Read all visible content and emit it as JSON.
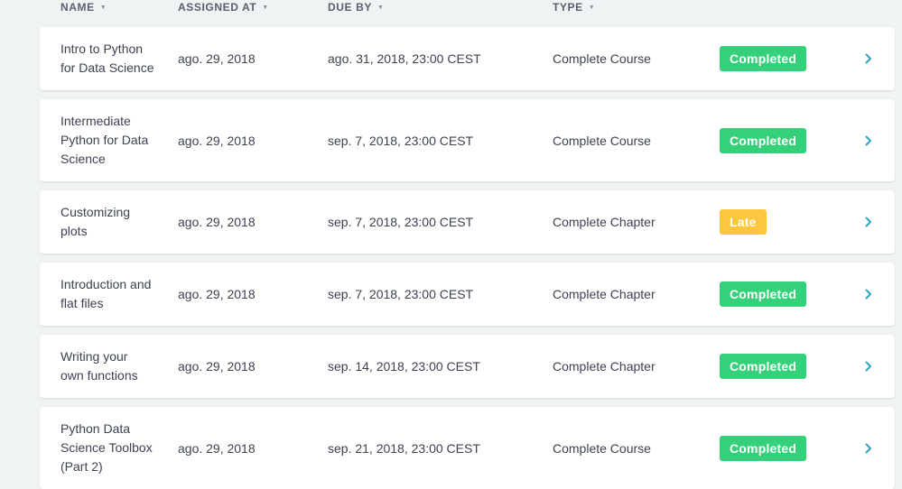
{
  "columns": {
    "name": "NAME",
    "assigned_at": "ASSIGNED AT",
    "due_by": "DUE BY",
    "type": "TYPE"
  },
  "colors": {
    "completed": "#34d17a",
    "late": "#fec63f",
    "chevron": "#33a3c0"
  },
  "rows": [
    {
      "name_lines": [
        "Intro to Python",
        "for Data Science"
      ],
      "assigned": "ago. 29, 2018",
      "due": "ago. 31, 2018, 23:00 CEST",
      "type": "Complete Course",
      "status": "Completed",
      "status_kind": "completed"
    },
    {
      "name_lines": [
        "Intermediate",
        "Python for Data",
        "Science"
      ],
      "assigned": "ago. 29, 2018",
      "due": "sep. 7, 2018, 23:00 CEST",
      "type": "Complete Course",
      "status": "Completed",
      "status_kind": "completed"
    },
    {
      "name_lines": [
        "Customizing",
        "plots"
      ],
      "assigned": "ago. 29, 2018",
      "due": "sep. 7, 2018, 23:00 CEST",
      "type": "Complete Chapter",
      "status": "Late",
      "status_kind": "late"
    },
    {
      "name_lines": [
        "Introduction and",
        "flat files"
      ],
      "assigned": "ago. 29, 2018",
      "due": "sep. 7, 2018, 23:00 CEST",
      "type": "Complete Chapter",
      "status": "Completed",
      "status_kind": "completed"
    },
    {
      "name_lines": [
        "Writing your",
        "own functions"
      ],
      "assigned": "ago. 29, 2018",
      "due": "sep. 14, 2018, 23:00 CEST",
      "type": "Complete Chapter",
      "status": "Completed",
      "status_kind": "completed"
    },
    {
      "name_lines": [
        "Python Data",
        "Science Toolbox",
        "(Part 2)"
      ],
      "assigned": "ago. 29, 2018",
      "due": "sep. 21, 2018, 23:00 CEST",
      "type": "Complete Course",
      "status": "Completed",
      "status_kind": "completed"
    }
  ]
}
